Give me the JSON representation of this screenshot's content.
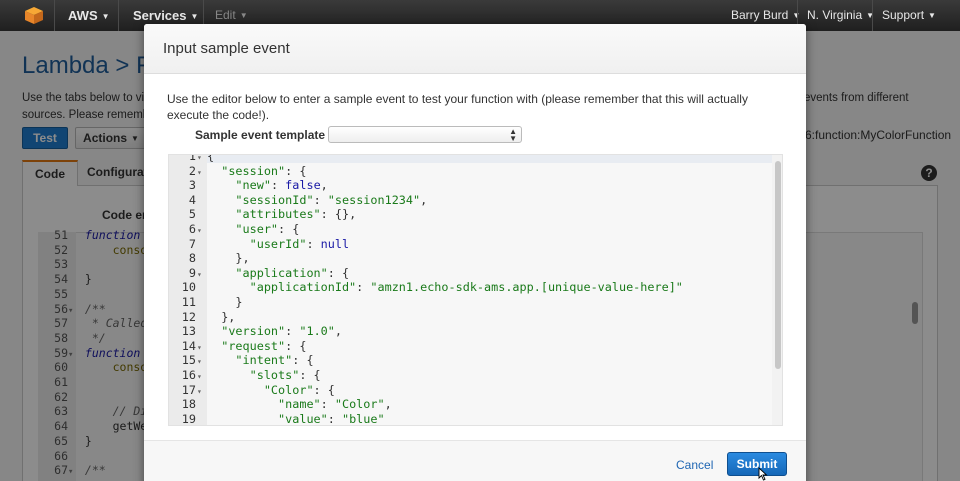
{
  "nav": {
    "logo_icon": "aws-cube-icon",
    "aws": "AWS",
    "services": "Services",
    "edit": "Edit",
    "user": "Barry Burd",
    "region": "N. Virginia",
    "support": "Support"
  },
  "page": {
    "title": "Lambda > Fu",
    "intro_line1": "Use the tabs below to vie",
    "intro_line2": "sources. Please remembe",
    "intro_right": "events from different",
    "test_button": "Test",
    "actions_button": "Actions",
    "arn_fragment": "6:function:MyColorFunction",
    "tab_code": "Code",
    "tab_configuration": "Configurati",
    "help": "?",
    "code_entry_label": "Code en",
    "bg_code_lines": [
      {
        "n": "51",
        "marker": "",
        "text": "function d",
        "cls": "k"
      },
      {
        "n": "52",
        "marker": "",
        "text": "    conso",
        "cls": "f"
      },
      {
        "n": "53",
        "marker": "",
        "text": "",
        "cls": "c"
      },
      {
        "n": "54",
        "marker": "",
        "text": "}",
        "cls": "c"
      },
      {
        "n": "55",
        "marker": "",
        "text": "",
        "cls": "c"
      },
      {
        "n": "56",
        "marker": "▾",
        "text": "/**",
        "cls": "cm"
      },
      {
        "n": "57",
        "marker": "",
        "text": " * Called",
        "cls": "cm"
      },
      {
        "n": "58",
        "marker": "",
        "text": " */",
        "cls": "cm"
      },
      {
        "n": "59",
        "marker": "▾",
        "text": "function o",
        "cls": "k"
      },
      {
        "n": "60",
        "marker": "",
        "text": "    consol",
        "cls": "f"
      },
      {
        "n": "61",
        "marker": "",
        "text": "",
        "cls": "c"
      },
      {
        "n": "62",
        "marker": "",
        "text": "",
        "cls": "c"
      },
      {
        "n": "63",
        "marker": "",
        "text": "    // Dis",
        "cls": "cm"
      },
      {
        "n": "64",
        "marker": "",
        "text": "    getWel",
        "cls": "c"
      },
      {
        "n": "65",
        "marker": "",
        "text": "}",
        "cls": "c"
      },
      {
        "n": "66",
        "marker": "",
        "text": "",
        "cls": "c"
      },
      {
        "n": "67",
        "marker": "▾",
        "text": "/**",
        "cls": "cm"
      }
    ]
  },
  "modal": {
    "title": "Input sample event",
    "description": "Use the editor below to enter a sample event to test your function with (please remember that this will actually execute the code!).",
    "template_label": "Sample event template",
    "template_value": "",
    "cancel": "Cancel",
    "submit": "Submit",
    "code_lines": [
      {
        "n": "1",
        "fold": true,
        "html": "{"
      },
      {
        "n": "2",
        "fold": true,
        "html": "  <span class=\"str\">\"session\"</span>: {"
      },
      {
        "n": "3",
        "fold": false,
        "html": "    <span class=\"str\">\"new\"</span>: <span class=\"kw\">false</span>,"
      },
      {
        "n": "4",
        "fold": false,
        "html": "    <span class=\"str\">\"sessionId\"</span>: <span class=\"str\">\"session1234\"</span>,"
      },
      {
        "n": "5",
        "fold": false,
        "html": "    <span class=\"str\">\"attributes\"</span>: {},"
      },
      {
        "n": "6",
        "fold": true,
        "html": "    <span class=\"str\">\"user\"</span>: {"
      },
      {
        "n": "7",
        "fold": false,
        "html": "      <span class=\"str\">\"userId\"</span>: <span class=\"kw\">null</span>"
      },
      {
        "n": "8",
        "fold": false,
        "html": "    },"
      },
      {
        "n": "9",
        "fold": true,
        "html": "    <span class=\"str\">\"application\"</span>: {"
      },
      {
        "n": "10",
        "fold": false,
        "html": "      <span class=\"str\">\"applicationId\"</span>: <span class=\"str\">\"amzn1.echo-sdk-ams.app.[unique-value-here]\"</span>"
      },
      {
        "n": "11",
        "fold": false,
        "html": "    }"
      },
      {
        "n": "12",
        "fold": false,
        "html": "  },"
      },
      {
        "n": "13",
        "fold": false,
        "html": "  <span class=\"str\">\"version\"</span>: <span class=\"str\">\"1.0\"</span>,"
      },
      {
        "n": "14",
        "fold": true,
        "html": "  <span class=\"str\">\"request\"</span>: {"
      },
      {
        "n": "15",
        "fold": true,
        "html": "    <span class=\"str\">\"intent\"</span>: {"
      },
      {
        "n": "16",
        "fold": true,
        "html": "      <span class=\"str\">\"slots\"</span>: {"
      },
      {
        "n": "17",
        "fold": true,
        "html": "        <span class=\"str\">\"Color\"</span>: {"
      },
      {
        "n": "18",
        "fold": false,
        "html": "          <span class=\"str\">\"name\"</span>: <span class=\"str\">\"Color\"</span>,"
      },
      {
        "n": "19",
        "fold": false,
        "html": "          <span class=\"str\">\"value\"</span>: <span class=\"str\">\"blue\"</span>"
      }
    ]
  },
  "colors": {
    "nav_bg": "#2b2b2b",
    "title_blue": "#1f5e9c",
    "button_blue": "#1f7fd1",
    "string_green": "#1a7a1a",
    "keyword_blue": "#1a1aa6",
    "tab_accent": "#e47911"
  }
}
